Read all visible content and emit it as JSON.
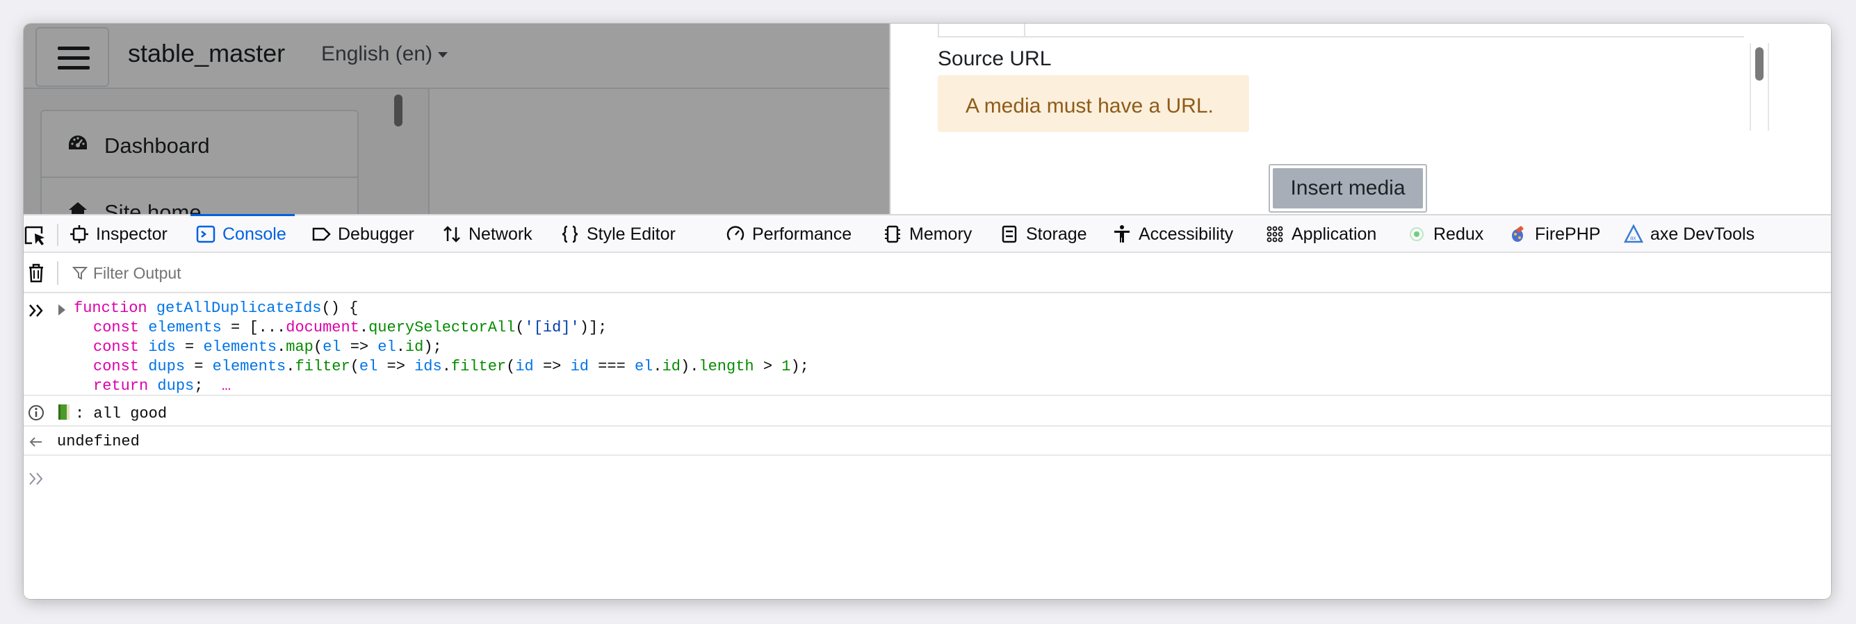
{
  "page": {
    "site_name": "stable_master",
    "language": "English (en)",
    "drawer_items": [
      "Dashboard",
      "Site home"
    ]
  },
  "modal": {
    "source_label": "Source URL",
    "alert": "A media must have a URL.",
    "insert_button": "Insert media"
  },
  "devtools": {
    "tabs": [
      "Inspector",
      "Console",
      "Debugger",
      "Network",
      "Style Editor",
      "Performance",
      "Memory",
      "Storage",
      "Accessibility",
      "Application",
      "Redux",
      "FirePHP",
      "axe DevTools"
    ],
    "selected_tab": "Console",
    "filter_placeholder": "Filter Output",
    "output": {
      "info_message": ": all good",
      "result": "undefined"
    }
  }
}
